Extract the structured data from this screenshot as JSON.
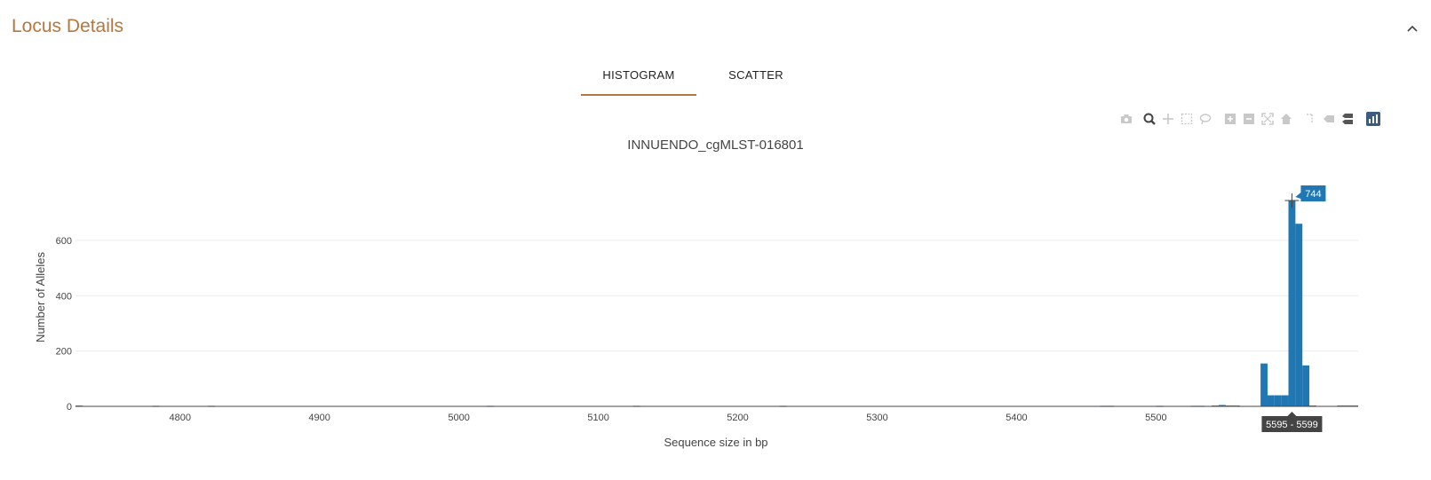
{
  "panel": {
    "title": "Locus Details"
  },
  "tabs": [
    {
      "label": "HISTOGRAM",
      "active": true
    },
    {
      "label": "SCATTER",
      "active": false
    }
  ],
  "modebar": [
    "camera-icon",
    "zoom-icon",
    "pan-icon",
    "box-select-icon",
    "lasso-select-icon",
    "zoom-in-icon",
    "zoom-out-icon",
    "autoscale-icon",
    "reset-axes-icon",
    "spike-lines-icon",
    "hover-closest-icon",
    "hover-compare-icon",
    "plotly-logo-icon"
  ],
  "colors": {
    "accent": "#b5773f",
    "bar": "#1f77b4",
    "tooltip": "#444444"
  },
  "chart_data": {
    "type": "bar",
    "title": "INNUENDO_cgMLST-016801",
    "xlabel": "Sequence size in bp",
    "ylabel": "Number of Alleles",
    "xlim": [
      4725,
      5645
    ],
    "ylim": [
      0,
      744
    ],
    "bin_size": 5,
    "x_ticks": [
      4800,
      4900,
      5000,
      5100,
      5200,
      5300,
      5400,
      5500
    ],
    "y_ticks": [
      0,
      200,
      400,
      600
    ],
    "bins": [
      {
        "start": 4725,
        "count": 3
      },
      {
        "start": 4780,
        "count": 2
      },
      {
        "start": 4820,
        "count": 2
      },
      {
        "start": 5020,
        "count": 2
      },
      {
        "start": 5125,
        "count": 2
      },
      {
        "start": 5230,
        "count": 2
      },
      {
        "start": 5460,
        "count": 2
      },
      {
        "start": 5465,
        "count": 2
      },
      {
        "start": 5500,
        "count": 2
      },
      {
        "start": 5525,
        "count": 2
      },
      {
        "start": 5530,
        "count": 2
      },
      {
        "start": 5540,
        "count": 3
      },
      {
        "start": 5545,
        "count": 5
      },
      {
        "start": 5550,
        "count": 3
      },
      {
        "start": 5555,
        "count": 3
      },
      {
        "start": 5575,
        "count": 155
      },
      {
        "start": 5580,
        "count": 40
      },
      {
        "start": 5585,
        "count": 40
      },
      {
        "start": 5590,
        "count": 40
      },
      {
        "start": 5595,
        "count": 744
      },
      {
        "start": 5600,
        "count": 660
      },
      {
        "start": 5605,
        "count": 148
      },
      {
        "start": 5610,
        "count": 3
      },
      {
        "start": 5630,
        "count": 3
      },
      {
        "start": 5635,
        "count": 3
      },
      {
        "start": 5640,
        "count": 3
      }
    ],
    "hover": {
      "value": "744",
      "range": "5595 - 5599",
      "bin_start": 5595
    }
  }
}
